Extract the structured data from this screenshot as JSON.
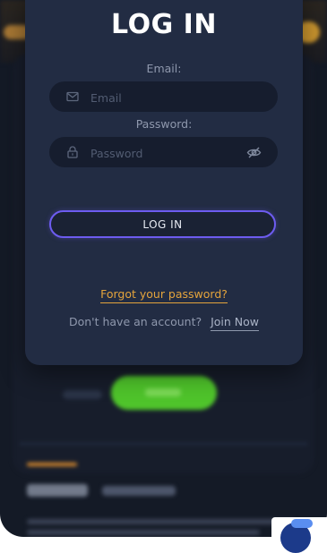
{
  "login": {
    "title": "LOG IN",
    "email_label": "Email:",
    "email_placeholder": "Email",
    "password_label": "Password:",
    "password_placeholder": "Password",
    "submit_label": "LOG IN",
    "forgot_link": "Forgot your password?",
    "no_account_text": "Don't have an account?",
    "join_link": "Join Now"
  },
  "icons": {
    "email": "mail-icon",
    "password": "lock-icon",
    "visibility": "eye-off-icon"
  },
  "colors": {
    "background": "#141a26",
    "modal": "#222c43",
    "field": "#161d2e",
    "accent_button_border": "#6d5cf0",
    "link": "#e4a43c",
    "background_cta": "#4fc42b"
  }
}
